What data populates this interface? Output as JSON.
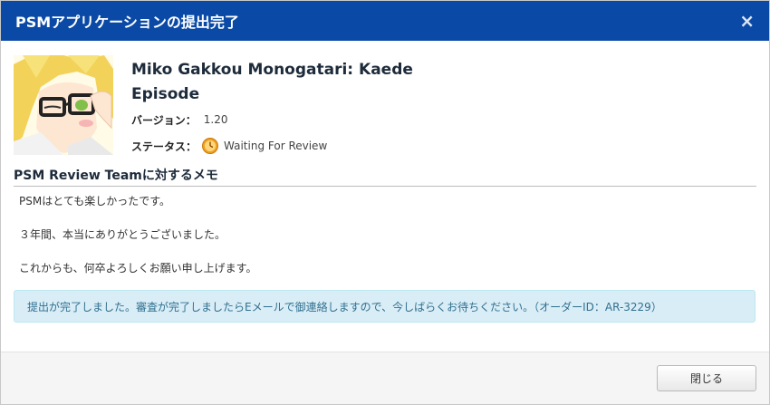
{
  "dialog": {
    "title": "PSMアプリケーションの提出完了",
    "close_icon": "×"
  },
  "app": {
    "name": "Miko Gakkou Monogatari: Kaede Episode",
    "version_label": "バージョン：",
    "version_value": "1.20",
    "status_label": "ステータス：",
    "status_value": "Waiting For Review",
    "status_icon": "clock-icon"
  },
  "memo": {
    "heading": "PSM Review Teamに対するメモ",
    "lines": [
      "PSMはとても楽しかったです。",
      "３年間、本当にありがとうございました。",
      "これからも、何卒よろしくお願い申し上げます。"
    ]
  },
  "alert": {
    "text": "提出が完了しました。審査が完了しましたらEメールで御連絡しますので、今しばらくお待ちください。（オーダーID：AR-3229）"
  },
  "footer": {
    "close_label": "閉じる"
  },
  "colors": {
    "header": "#0a4aa6",
    "alert_bg": "#d9edf7",
    "alert_text": "#31708f"
  }
}
